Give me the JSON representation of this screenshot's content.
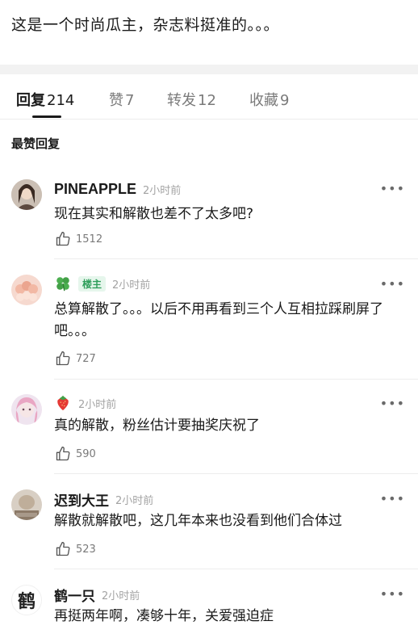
{
  "post": {
    "text": "这是一个时尚瓜主，杂志料挺准的。。。"
  },
  "tabs": [
    {
      "label": "回复",
      "count": "214"
    },
    {
      "label": "赞",
      "count": "7"
    },
    {
      "label": "转发",
      "count": "12"
    },
    {
      "label": "收藏",
      "count": "9"
    }
  ],
  "section_title": "最赞回复",
  "more_label": "•••",
  "comments": [
    {
      "name": "PINEAPPLE",
      "time": "2小时前",
      "text": "现在其实和解散也差不了太多吧?",
      "likes": "1512"
    },
    {
      "name": "",
      "badge": "楼主",
      "time": "2小时前",
      "text": "总算解散了。。。以后不用再看到三个人互相拉踩刷屏了吧。。。",
      "likes": "727",
      "name_icon": "four-leaf-clover-icon"
    },
    {
      "name": "",
      "time": "2小时前",
      "text": "真的解散，粉丝估计要抽奖庆祝了",
      "likes": "590",
      "name_icon": "strawberry-icon"
    },
    {
      "name": "迟到大王",
      "time": "2小时前",
      "text": "解散就解散吧，这几年本来也没看到他们合体过",
      "likes": "523"
    },
    {
      "name": "鹤一只",
      "time": "2小时前",
      "text": "再挺两年啊，凑够十年，关爱强迫症",
      "avatar_text": "鹤"
    }
  ],
  "colors": {
    "accent_green": "#2f9e5b",
    "muted": "#a3a3a3"
  }
}
